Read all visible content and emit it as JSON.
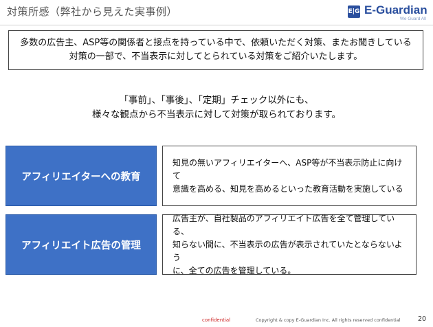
{
  "header": {
    "title": "対策所感（弊社から見えた実事例）",
    "logo_mark": "E|G",
    "logo_name": "E-Guardian",
    "logo_tagline": "We Guard All"
  },
  "intro": {
    "line1": "多数の広告主、ASP等の関係者と接点を持っている中で、依頼いただく対策、またお聞きしている",
    "line2": "対策の一部で、不当表示に対してとられている対策をご紹介いたします。"
  },
  "lead": {
    "line1": "「事前」、「事後」、「定期」チェック以外にも、",
    "line2": "様々な観点から不当表示に対して対策が取られております。"
  },
  "measures": [
    {
      "label": "アフィリエイターへの教育",
      "desc1": "知見の無いアフィリエイターへ、ASP等が不当表示防止に向けて",
      "desc2": "意識を高める、知見を高めるといった教育活動を実施している",
      "desc3": ""
    },
    {
      "label": "アフィリエイト広告の管理",
      "desc1": "広告主が、自社製品のアフィリエイト広告を全て管理している、",
      "desc2": "知らない間に、不当表示の広告が表示されていたとならないよう",
      "desc3": "に、全ての広告を管理している。"
    }
  ],
  "footer": {
    "confidential": "confidential",
    "copyright": "Copyright & copy E-Guardian Inc.  All rights reserved  confidential",
    "page": "20"
  },
  "colors": {
    "accent_blue": "#3e71c6",
    "logo_blue": "#2a4f9e",
    "confidential_red": "#cc2222"
  }
}
